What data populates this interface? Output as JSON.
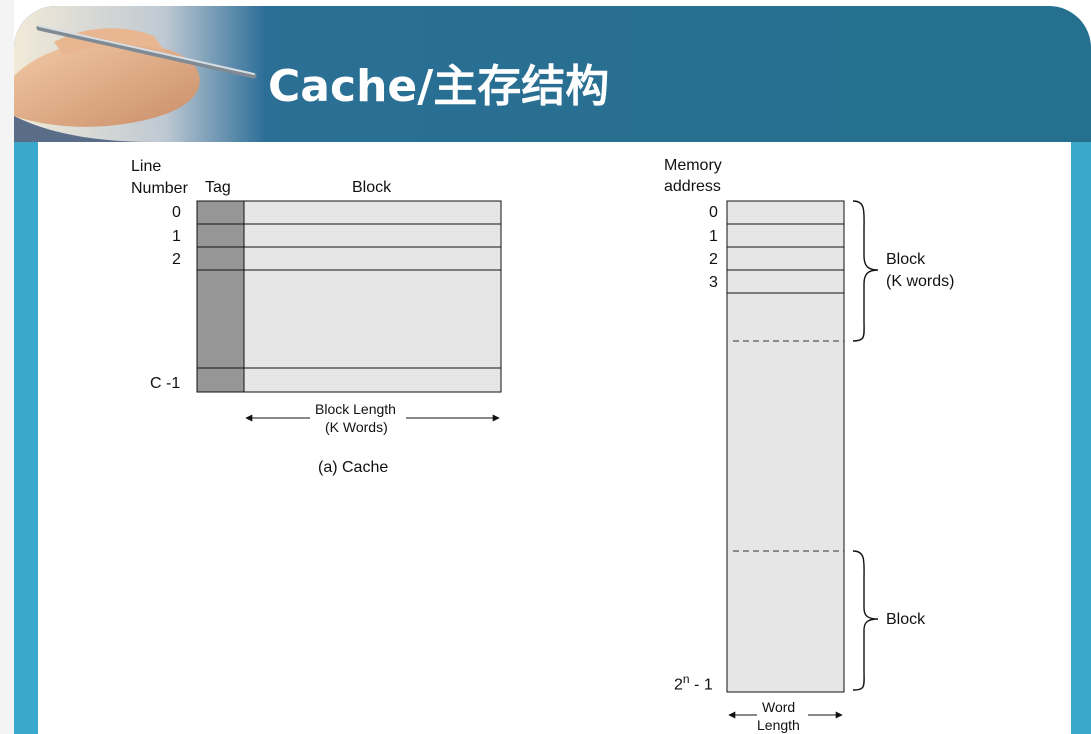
{
  "slide": {
    "title": "Cache/主存结构"
  },
  "cache": {
    "header_line": "Line",
    "header_number": "Number",
    "header_tag": "Tag",
    "header_block": "Block",
    "rows": [
      "0",
      "1",
      "2",
      "C -1"
    ],
    "dots": ".",
    "length_label_1": "Block Length",
    "length_label_2": "(K Words)",
    "caption": "(a) Cache"
  },
  "memory": {
    "header_1": "Memory",
    "header_2": "address",
    "rows": [
      "0",
      "1",
      "2",
      "3"
    ],
    "last_row_base": "2",
    "last_row_exp": "n",
    "last_row_suffix": " - 1",
    "brace_top_1": "Block",
    "brace_top_2": "(K words)",
    "brace_bottom": "Block",
    "width_label_1": "Word",
    "width_label_2": "Length"
  },
  "colors": {
    "header_bg": "#296f93",
    "side_bar": "#3aa8cb",
    "tag_fill": "#969696",
    "cell_fill": "#e6e6e6"
  }
}
